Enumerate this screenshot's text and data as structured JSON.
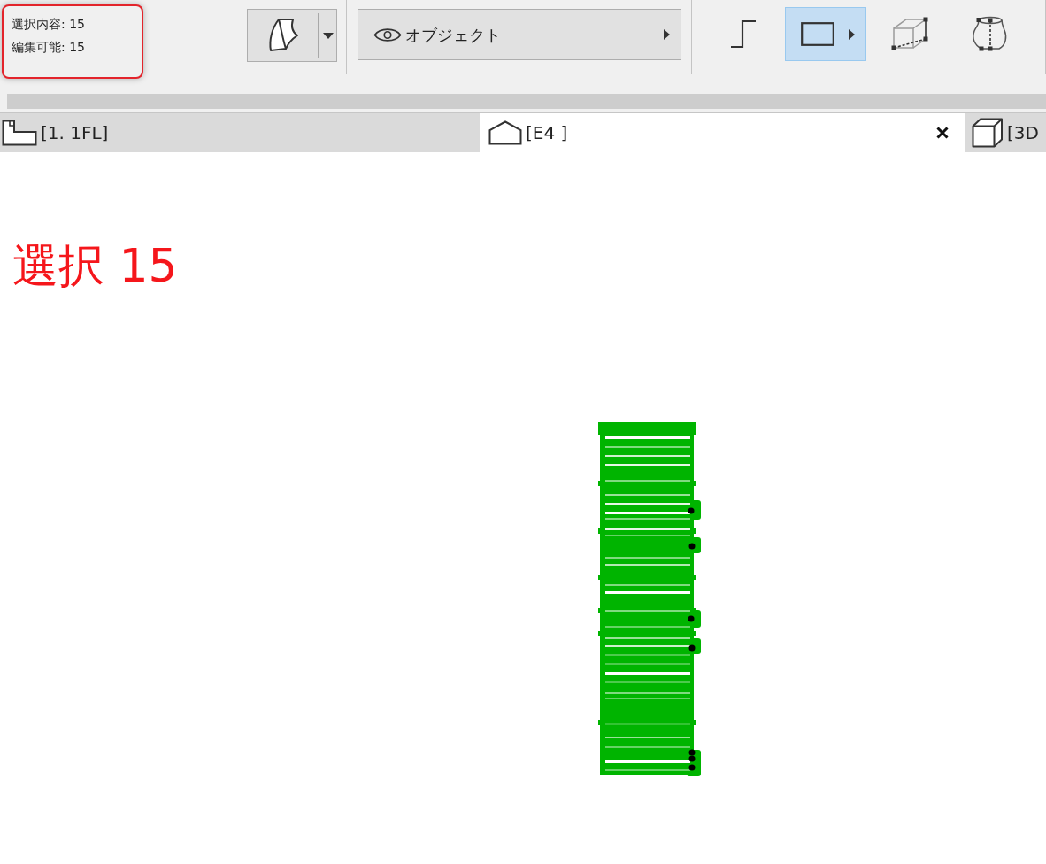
{
  "selection_info": {
    "selected": "選択内容: 15",
    "editable": "編集可能: 15"
  },
  "toolbar": {
    "view_filter": {
      "label": "オブジェクト"
    },
    "tools": [
      {
        "kind": "step",
        "selected": false,
        "submenu": false
      },
      {
        "kind": "rectangle",
        "selected": true,
        "submenu": true
      },
      {
        "kind": "cube",
        "selected": false,
        "submenu": false
      },
      {
        "kind": "vase",
        "selected": false,
        "submenu": false
      }
    ]
  },
  "tabs": [
    {
      "label": "[1. 1FL]",
      "kind": "plan",
      "selected": false,
      "closable": false
    },
    {
      "label": "[E4 ]",
      "kind": "elevation",
      "selected": true,
      "closable": true
    },
    {
      "label": "[3D",
      "kind": "model",
      "selected": false,
      "closable": false
    }
  ],
  "canvas": {
    "annotation": "選択 15"
  }
}
